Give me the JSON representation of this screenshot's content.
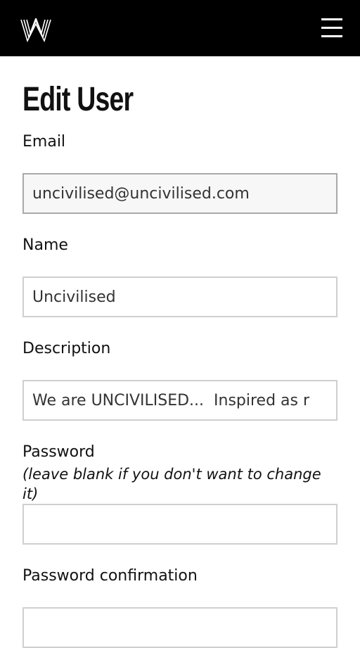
{
  "header": {
    "logo_icon": "w-logo-icon",
    "menu_icon": "hamburger-menu-icon"
  },
  "page": {
    "title": "Edit User"
  },
  "form": {
    "email": {
      "label": "Email",
      "value": "uncivilised@uncivilised.com"
    },
    "name": {
      "label": "Name",
      "value": "Uncivilised"
    },
    "description": {
      "label": "Description",
      "value": "We are UNCIVILISED...  Inspired as r"
    },
    "password": {
      "label": "Password",
      "hint": "(leave blank if you don't want to change it)",
      "value": ""
    },
    "password_confirmation": {
      "label": "Password confirmation",
      "value": ""
    }
  }
}
